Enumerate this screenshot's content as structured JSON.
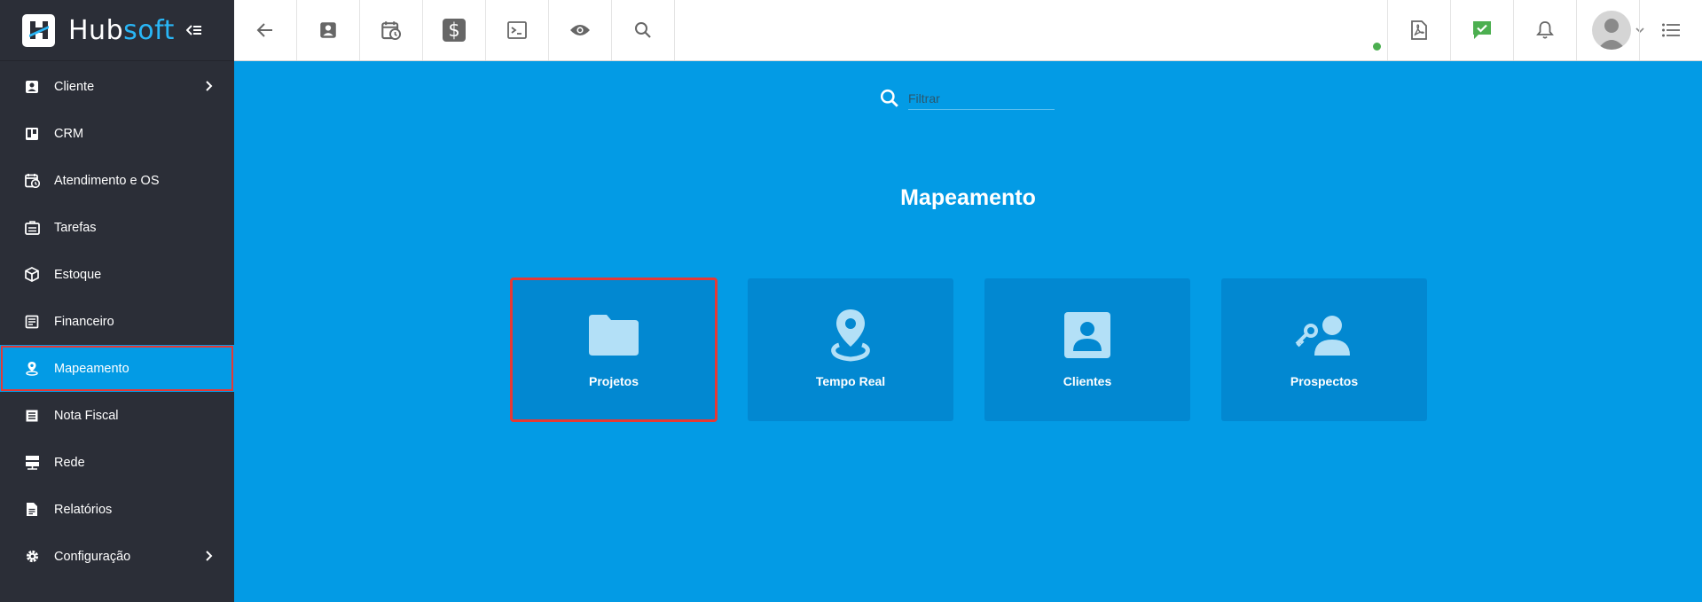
{
  "brand": {
    "name_part1": "Hub",
    "name_part2": "soft"
  },
  "sidebar": {
    "items": [
      {
        "label": "Cliente",
        "icon": "contact-card-icon",
        "has_submenu": true
      },
      {
        "label": "CRM",
        "icon": "kanban-board-icon",
        "has_submenu": false
      },
      {
        "label": "Atendimento e OS",
        "icon": "calendar-clock-icon",
        "has_submenu": false
      },
      {
        "label": "Tarefas",
        "icon": "task-list-icon",
        "has_submenu": false
      },
      {
        "label": "Estoque",
        "icon": "cube-icon",
        "has_submenu": false
      },
      {
        "label": "Financeiro",
        "icon": "receipt-icon",
        "has_submenu": false
      },
      {
        "label": "Mapeamento",
        "icon": "map-pin-icon",
        "has_submenu": false,
        "active": true
      },
      {
        "label": "Nota Fiscal",
        "icon": "document-lines-icon",
        "has_submenu": false
      },
      {
        "label": "Rede",
        "icon": "server-icon",
        "has_submenu": false
      },
      {
        "label": "Relatórios",
        "icon": "report-icon",
        "has_submenu": false
      },
      {
        "label": "Configuração",
        "icon": "gear-icon",
        "has_submenu": true
      }
    ]
  },
  "topbar": {
    "left_buttons": [
      "back-arrow-icon",
      "contact-card-icon",
      "calendar-clock-icon",
      "dollar-icon",
      "terminal-icon",
      "eye-icon",
      "search-icon"
    ],
    "right_buttons": [
      "pdf-icon",
      "chat-check-icon",
      "bell-icon",
      "avatar",
      "menu-list-icon"
    ]
  },
  "main": {
    "filter_placeholder": "Filtrar",
    "title": "Mapeamento",
    "cards": [
      {
        "label": "Projetos",
        "icon": "folder-icon",
        "selected": true
      },
      {
        "label": "Tempo Real",
        "icon": "location-pin-icon",
        "selected": false
      },
      {
        "label": "Clientes",
        "icon": "contact-card-icon",
        "selected": false
      },
      {
        "label": "Prospectos",
        "icon": "user-key-icon",
        "selected": false
      }
    ]
  },
  "colors": {
    "sidebar_bg": "#2B2E37",
    "main_bg": "#039BE5",
    "card_bg": "#0288D1",
    "highlight_border": "#E53935",
    "brand_accent": "#29B6F6",
    "status_green": "#4CAF50"
  }
}
